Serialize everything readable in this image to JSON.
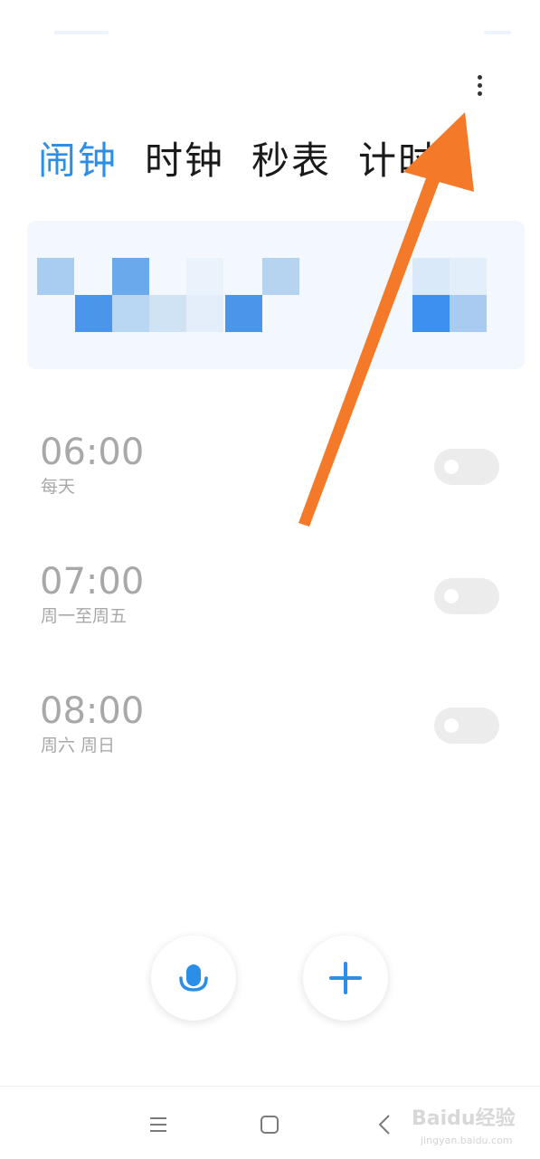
{
  "tabs": [
    {
      "label": "闹钟",
      "active": true
    },
    {
      "label": "时钟",
      "active": false
    },
    {
      "label": "秒表",
      "active": false
    },
    {
      "label": "计时",
      "active": false
    }
  ],
  "alarms": [
    {
      "time": "06:00",
      "repeat": "每天",
      "enabled": false
    },
    {
      "time": "07:00",
      "repeat": "周一至周五",
      "enabled": false
    },
    {
      "time": "08:00",
      "repeat": "周六 周日",
      "enabled": false
    }
  ],
  "icons": {
    "more": "more-vertical-icon",
    "voice": "microphone-icon",
    "add": "plus-icon",
    "nav_menu": "menu-icon",
    "nav_home": "home-square-icon",
    "nav_back": "back-chevron-icon"
  },
  "colors": {
    "accent": "#2b8ee8",
    "annotation_arrow": "#f47a2a",
    "muted_text": "#a8a8a8",
    "toggle_off": "#ececec"
  },
  "watermark": {
    "brand": "Baidu经验",
    "url": "jingyan.baidu.com"
  }
}
